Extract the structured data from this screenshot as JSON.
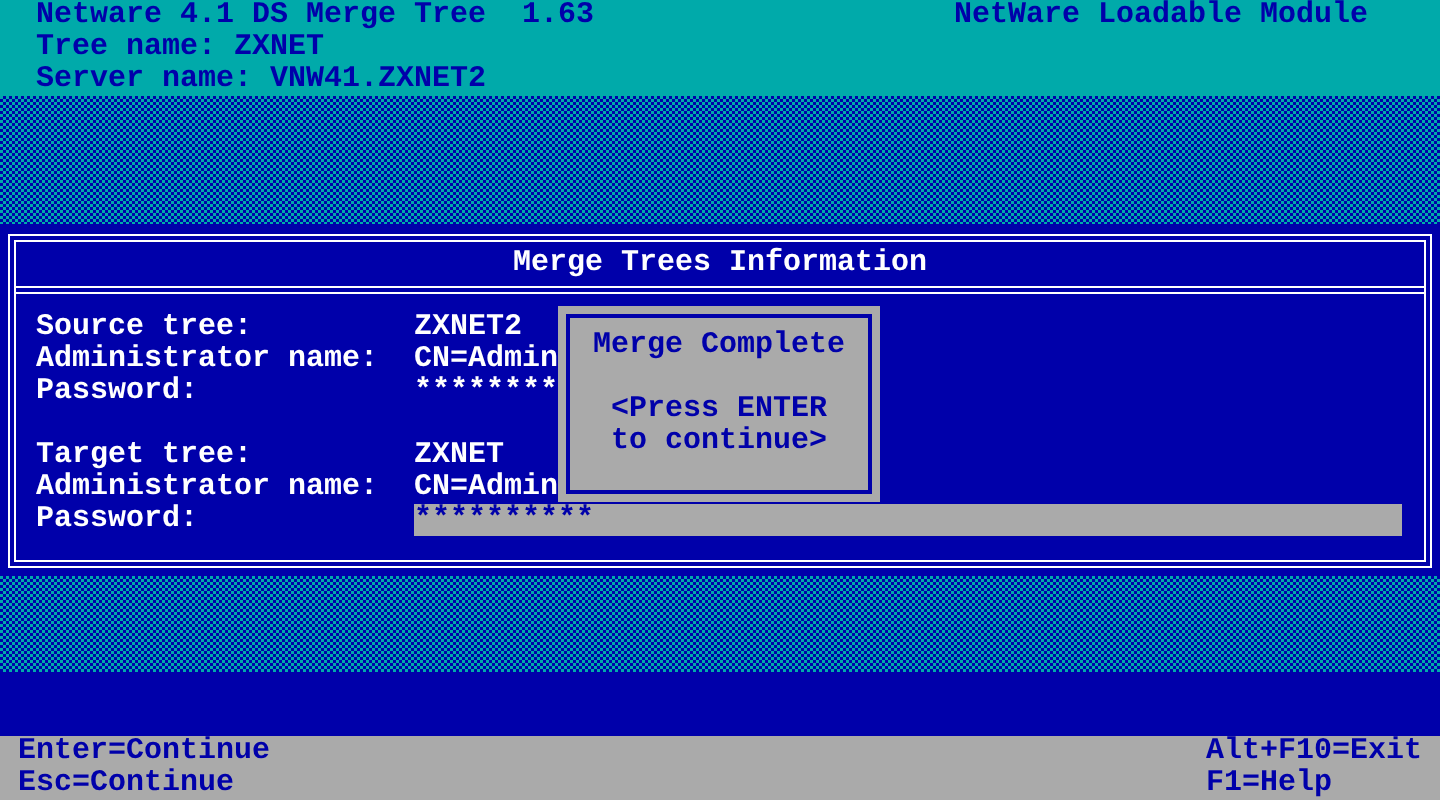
{
  "header": {
    "title": "Netware 4.1 DS Merge Tree  1.63",
    "module": "NetWare Loadable Module",
    "lines": [
      "Tree name: ZXNET",
      "Server name: VNW41.ZXNET2"
    ]
  },
  "dialog": {
    "title": "Merge Trees Information",
    "groups": [
      {
        "fields": [
          {
            "label": "Source tree:",
            "value": "ZXNET2",
            "selected": false
          },
          {
            "label": "Administrator name:",
            "value": "CN=Admin",
            "selected": false
          },
          {
            "label": "Password:",
            "value": "********",
            "selected": false
          }
        ]
      },
      {
        "fields": [
          {
            "label": "Target tree:",
            "value": "ZXNET",
            "selected": false
          },
          {
            "label": "Administrator name:",
            "value": "CN=Admin",
            "selected": false
          },
          {
            "label": "Password:",
            "value": "**********",
            "selected": true
          }
        ]
      }
    ]
  },
  "popup": {
    "title": "Merge Complete",
    "lines": [
      "<Press ENTER",
      "to continue>"
    ]
  },
  "footer": {
    "left": [
      "Enter=Continue",
      "Esc=Continue"
    ],
    "right": [
      "Alt+F10=Exit",
      "F1=Help"
    ]
  }
}
